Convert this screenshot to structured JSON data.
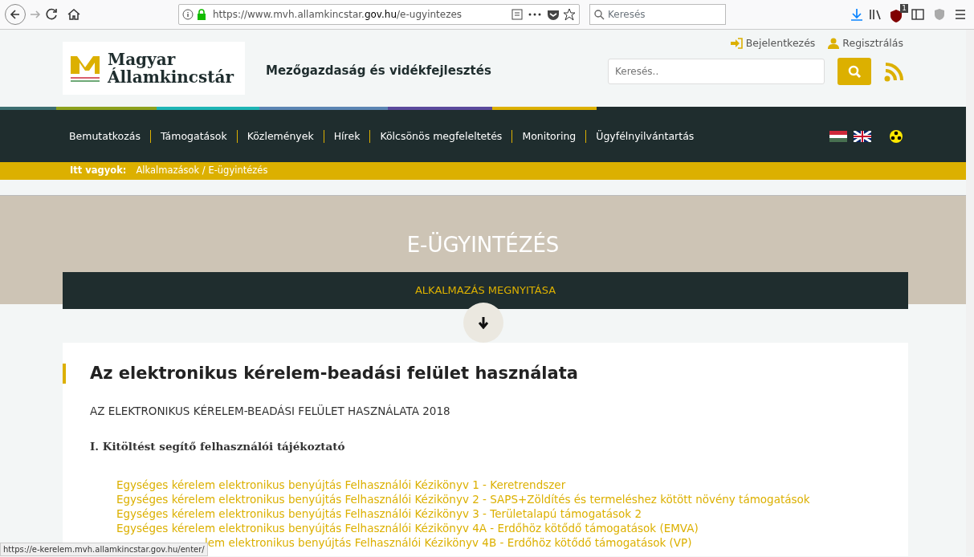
{
  "browser": {
    "url_prefix": "https://www.mvh.allamkincstar.",
    "url_domain": "gov.hu",
    "url_path": "/e-ugyintezes",
    "search_placeholder": "Keresés",
    "badge": "1"
  },
  "header": {
    "logo_line1": "Magyar",
    "logo_line2": "Államkincstár",
    "tagline": "Mezőgazdaság és vidékfejlesztés",
    "login": "Bejelentkezés",
    "register": "Regisztrálás",
    "search_placeholder": "Keresés.."
  },
  "nav": {
    "items": [
      "Bemutatkozás",
      "Támogatások",
      "Közlemények",
      "Hírek",
      "Kölcsönös megfeleltetés",
      "Monitoring",
      "Ügyfélnyilvántartás"
    ]
  },
  "breadcrumb": {
    "label": "Itt vagyok:",
    "path": "Alkalmazások / E-ügyintézés"
  },
  "banner": {
    "title": "E-ÜGYINTÉZÉS",
    "button": "ALKALMAZÁS MEGNYITÁSA"
  },
  "content": {
    "heading": "Az elektronikus kérelem-beadási felület használata",
    "subtitle": "AZ ELEKTRONIKUS KÉRELEM-BEADÁSI FELÜLET HASZNÁLATA 2018",
    "section": "I. Kitöltést segítő felhasználói tájékoztató",
    "links": [
      "Egységes kérelem elektronikus benyújtás Felhasználói Kézikönyv 1 - Keretrendszer",
      "Egységes kérelem elektronikus benyújtás Felhasználói Kézikönyv 2 - SAPS+Zöldítés és termeléshez kötött növény támogatások",
      "Egységes kérelem elektronikus benyújtás Felhasználói Kézikönyv 3 - Területalapú támogatások 2",
      "Egységes kérelem elektronikus benyújtás Felhasználói Kézikönyv 4A - Erdőhöz kötődő támogatások (EMVA)",
      "lem elektronikus benyújtás Felhasználói Kézikönyv 4B - Erdőhöz kötődő támogatások (VP)"
    ]
  },
  "status_url": "https://e-kerelem.mvh.allamkincstar.gov.hu/enter/"
}
